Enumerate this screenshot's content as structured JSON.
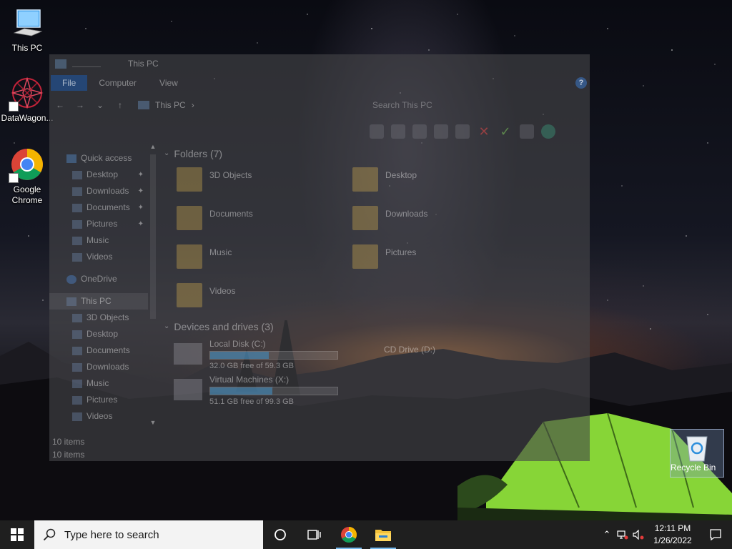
{
  "desktop": {
    "icons": [
      {
        "label": "This PC",
        "icon": "this-pc-icon"
      },
      {
        "label": "DataWagon...",
        "icon": "datawagon-icon"
      },
      {
        "label": "Google\nChrome",
        "icon": "chrome-icon"
      },
      {
        "label": "Recycle Bin",
        "icon": "recycle-bin-icon"
      }
    ]
  },
  "explorer": {
    "title": "This PC",
    "ribbon_tabs": [
      "File",
      "Computer",
      "View"
    ],
    "help": "?",
    "breadcrumb": "This PC",
    "search_placeholder": "Search This PC",
    "sidebar": {
      "quick_access": "Quick access",
      "quick_items": [
        "Desktop",
        "Downloads",
        "Documents",
        "Pictures",
        "Music",
        "Videos"
      ],
      "onedrive": "OneDrive",
      "this_pc": "This PC",
      "pc_items": [
        "3D Objects",
        "Desktop",
        "Documents",
        "Downloads",
        "Music",
        "Pictures",
        "Videos"
      ]
    },
    "folders_header": "Folders (7)",
    "folders": [
      "3D Objects",
      "Desktop",
      "Documents",
      "Downloads",
      "Music",
      "Pictures",
      "Videos"
    ],
    "devices_header": "Devices and drives (3)",
    "drives": [
      {
        "name": "Local Disk (C:)",
        "free": "32.0 GB free of 59.3 GB",
        "used_fraction": 0.46
      },
      {
        "name": "CD Drive (D:)",
        "free": "",
        "used_fraction": 0
      },
      {
        "name": "Virtual Machines (X:)",
        "free": "51.1 GB free of 99.3 GB",
        "used_fraction": 0.49
      }
    ],
    "status_count": "10 items",
    "status_count_bottom": "10 items"
  },
  "taskbar": {
    "search_placeholder": "Type here to search",
    "clock_time": "12:11 PM",
    "clock_date": "1/26/2022",
    "pinned": [
      "cortana-icon",
      "task-view-icon",
      "chrome-icon",
      "file-explorer-icon"
    ]
  },
  "colors": {
    "taskbar_bg": "#1f1f1f",
    "search_bg": "#f3f3f3",
    "active_underline": "#76b9ed",
    "tent_green": "#8ee03a"
  }
}
